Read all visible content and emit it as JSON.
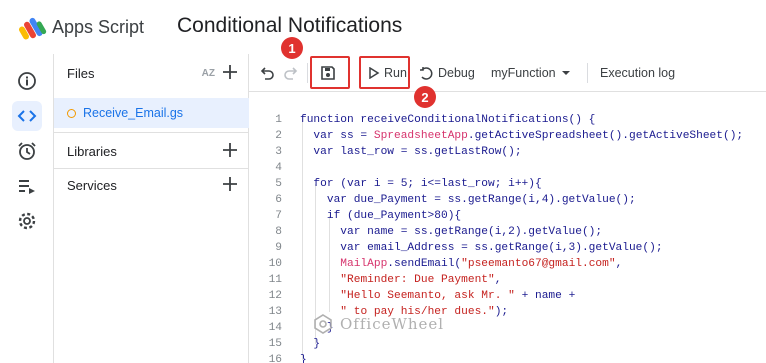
{
  "header": {
    "app_name": "Apps Script",
    "project_title": "Conditional Notifications",
    "logo_colors": [
      "#4285f4",
      "#ea4335",
      "#fbbc04",
      "#34a853"
    ]
  },
  "rail": {
    "items": [
      {
        "name": "overview-icon"
      },
      {
        "name": "editor-icon",
        "active": true
      },
      {
        "name": "triggers-icon"
      },
      {
        "name": "executions-icon"
      },
      {
        "name": "settings-icon"
      }
    ]
  },
  "files_panel": {
    "files_label": "Files",
    "sort_label": "AZ",
    "files": [
      {
        "name": "Receive_Email.gs"
      }
    ],
    "libraries_label": "Libraries",
    "services_label": "Services"
  },
  "toolbar": {
    "run_label": "Run",
    "debug_label": "Debug",
    "function_label": "myFunction",
    "execution_log_label": "Execution log"
  },
  "annotations": {
    "badge_1": "1",
    "badge_2": "2",
    "highlight_color": "#e0322f"
  },
  "editor": {
    "line_numbers": [
      "1",
      "2",
      "3",
      "4",
      "5",
      "6",
      "7",
      "8",
      "9",
      "10",
      "11",
      "12",
      "13",
      "14",
      "15",
      "16"
    ],
    "lines": [
      "function receiveConditionalNotifications() {",
      "  var ss = SpreadsheetApp.getActiveSpreadsheet().getActiveSheet();",
      "  var last_row = ss.getLastRow();",
      "",
      "  for (var i = 5; i<=last_row; i++){",
      "    var due_Payment = ss.getRange(i,4).getValue();",
      "    if (due_Payment>80){",
      "      var name = ss.getRange(i,2).getValue();",
      "      var email_Address = ss.getRange(i,3).getValue();",
      "      MailApp.sendEmail(\"pseemanto67@gmail.com\",",
      "      \"Reminder: Due Payment\",",
      "      \"Hello Seemanto, ask Mr. \" + name +",
      "      \" to pay his/her dues.\");",
      "    }",
      "  }",
      "}"
    ]
  },
  "watermark": "OfficeWheel"
}
